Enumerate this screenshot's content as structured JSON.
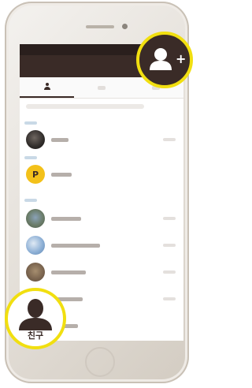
{
  "callouts": {
    "add_friend": {
      "icon": "add-friend-icon",
      "plus_glyph": "+"
    },
    "friends_tab": {
      "icon": "person-icon",
      "label": "친구"
    }
  },
  "list": {
    "plus_friend_avatar_glyph": "P"
  },
  "colors": {
    "header": "#3a2b27",
    "highlight": "#f1df10",
    "plus_friend": "#f3c11a"
  }
}
